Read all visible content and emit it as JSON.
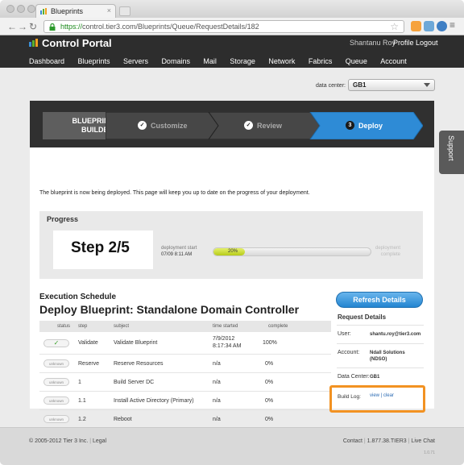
{
  "browser": {
    "tab_title": "Blueprints",
    "url_https": "https://",
    "url_rest": "control.tier3.com/Blueprints/Queue/RequestDetails/182"
  },
  "header": {
    "title": "Control Portal",
    "user_name": "Shantanu Roy",
    "profile": "Profile",
    "logout": "Logout",
    "nav": [
      "Dashboard",
      "Blueprints",
      "Servers",
      "Domains",
      "Mail",
      "Storage",
      "Network",
      "Fabrics",
      "Queue",
      "Account"
    ]
  },
  "datacenter": {
    "label": "data center:",
    "value": "GB1"
  },
  "support_label": "Support",
  "builder": {
    "title_line1": "BLUEPRINT",
    "title_line2": "BUILDER",
    "steps": [
      {
        "label": "Customize",
        "marker": "✓"
      },
      {
        "label": "Review",
        "marker": "✓"
      },
      {
        "label": "Deploy",
        "marker": "3"
      }
    ]
  },
  "intro_text": "The blueprint is now being deployed. This page will keep you up to date on the progress of your deployment.",
  "progress": {
    "title": "Progress",
    "step_text": "Step 2/5",
    "start_label": "deployment start",
    "start_time": "07/09 8:11 AM",
    "percent_label": "20%",
    "percent_value": 0.2,
    "complete_label_1": "deployment",
    "complete_label_2": "complete"
  },
  "execution": {
    "heading": "Execution Schedule",
    "title": "Deploy Blueprint: Standalone Domain Controller",
    "columns": [
      "status",
      "step",
      "subject",
      "time started",
      "complete"
    ],
    "rows": [
      {
        "status": "✓",
        "step": "Validate",
        "subject": "Validate Blueprint",
        "time": "7/9/2012 8:17:34 AM",
        "time_line1": "7/9/2012",
        "time_line2": "8:17:34 AM",
        "complete": "100%"
      },
      {
        "status": "unknown",
        "step": "Reserve",
        "subject": "Reserve Resources",
        "time": "n/a",
        "complete": "0%"
      },
      {
        "status": "unknown",
        "step": "1",
        "subject": "Build Server DC",
        "time": "n/a",
        "complete": "0%"
      },
      {
        "status": "unknown",
        "step": "1.1",
        "subject": "Install Active Directory (Primary)",
        "time": "n/a",
        "complete": "0%"
      },
      {
        "status": "unknown",
        "step": "1.2",
        "subject": "Reboot",
        "time": "n/a",
        "complete": "0%"
      }
    ]
  },
  "request": {
    "refresh_button": "Refresh Details",
    "title": "Request Details",
    "user_label": "User:",
    "user_value": "shantu.roy@tier3.com",
    "account_label": "Account:",
    "account_line1": "Ndall Solutions",
    "account_line2": "(NDSO)",
    "dc_label": "Data Center:",
    "dc_value": "GB1",
    "buildlog_label": "Build Log:",
    "buildlog_view": "view",
    "buildlog_sep": " | ",
    "buildlog_clear": "clear"
  },
  "footer": {
    "copyright": "© 2005-2012 Tier 3 Inc.",
    "legal": "Legal",
    "contact": "Contact",
    "phone": "1.877.38.TIER3",
    "livechat": "Live Chat",
    "version": "1.0.71"
  },
  "colors": {
    "accent_blue": "#2e8bd6",
    "progress_green": "#b6cb18",
    "highlight_orange": "#f29222",
    "header_dark": "#2d2d2d"
  }
}
